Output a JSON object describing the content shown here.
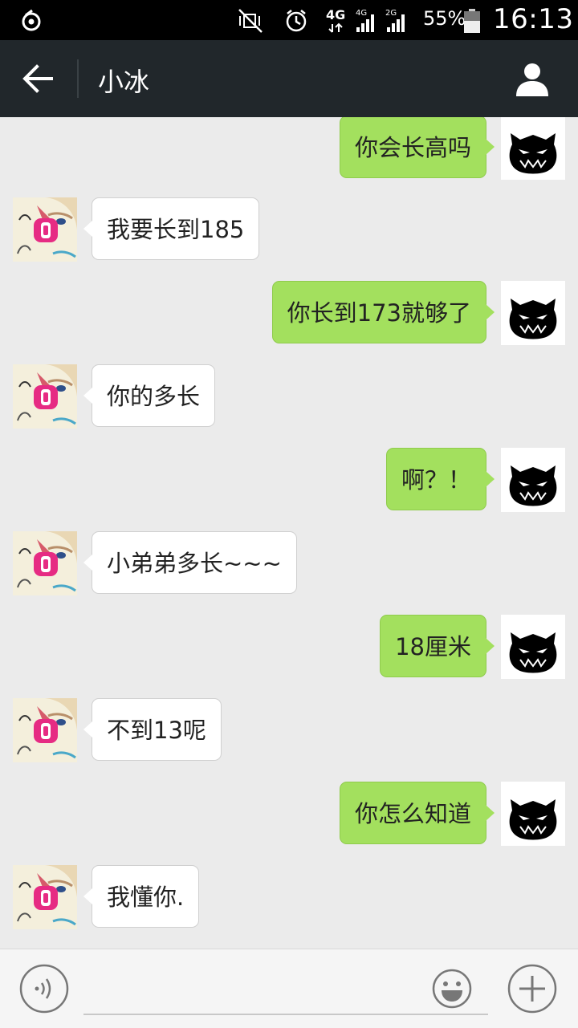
{
  "status_bar": {
    "network_4g": "4G",
    "sim1": "4G",
    "sim2": "2G",
    "battery": "55%",
    "time": "16:13"
  },
  "header": {
    "title": "小冰",
    "back_icon": "arrow-left-icon",
    "contact_icon": "person-icon"
  },
  "messages": [
    {
      "sender": "me",
      "text": "你会长高吗"
    },
    {
      "sender": "bot",
      "text": "我要长到185"
    },
    {
      "sender": "me",
      "text": "你长到173就够了"
    },
    {
      "sender": "bot",
      "text": "你的多长"
    },
    {
      "sender": "me",
      "text": "啊？！"
    },
    {
      "sender": "bot",
      "text": "小弟弟多长~~~"
    },
    {
      "sender": "me",
      "text": "18厘米"
    },
    {
      "sender": "bot",
      "text": "不到13呢"
    },
    {
      "sender": "me",
      "text": "你怎么知道"
    },
    {
      "sender": "bot",
      "text": "我懂你."
    }
  ],
  "input_bar": {
    "voice_icon": "voice-icon",
    "emoji_icon": "emoji-icon",
    "plus_icon": "plus-icon",
    "text": ""
  },
  "colors": {
    "me_bubble": "#a3e05e",
    "bot_bubble": "#ffffff",
    "header_bg": "#21272b",
    "chat_bg": "#ebebeb"
  }
}
